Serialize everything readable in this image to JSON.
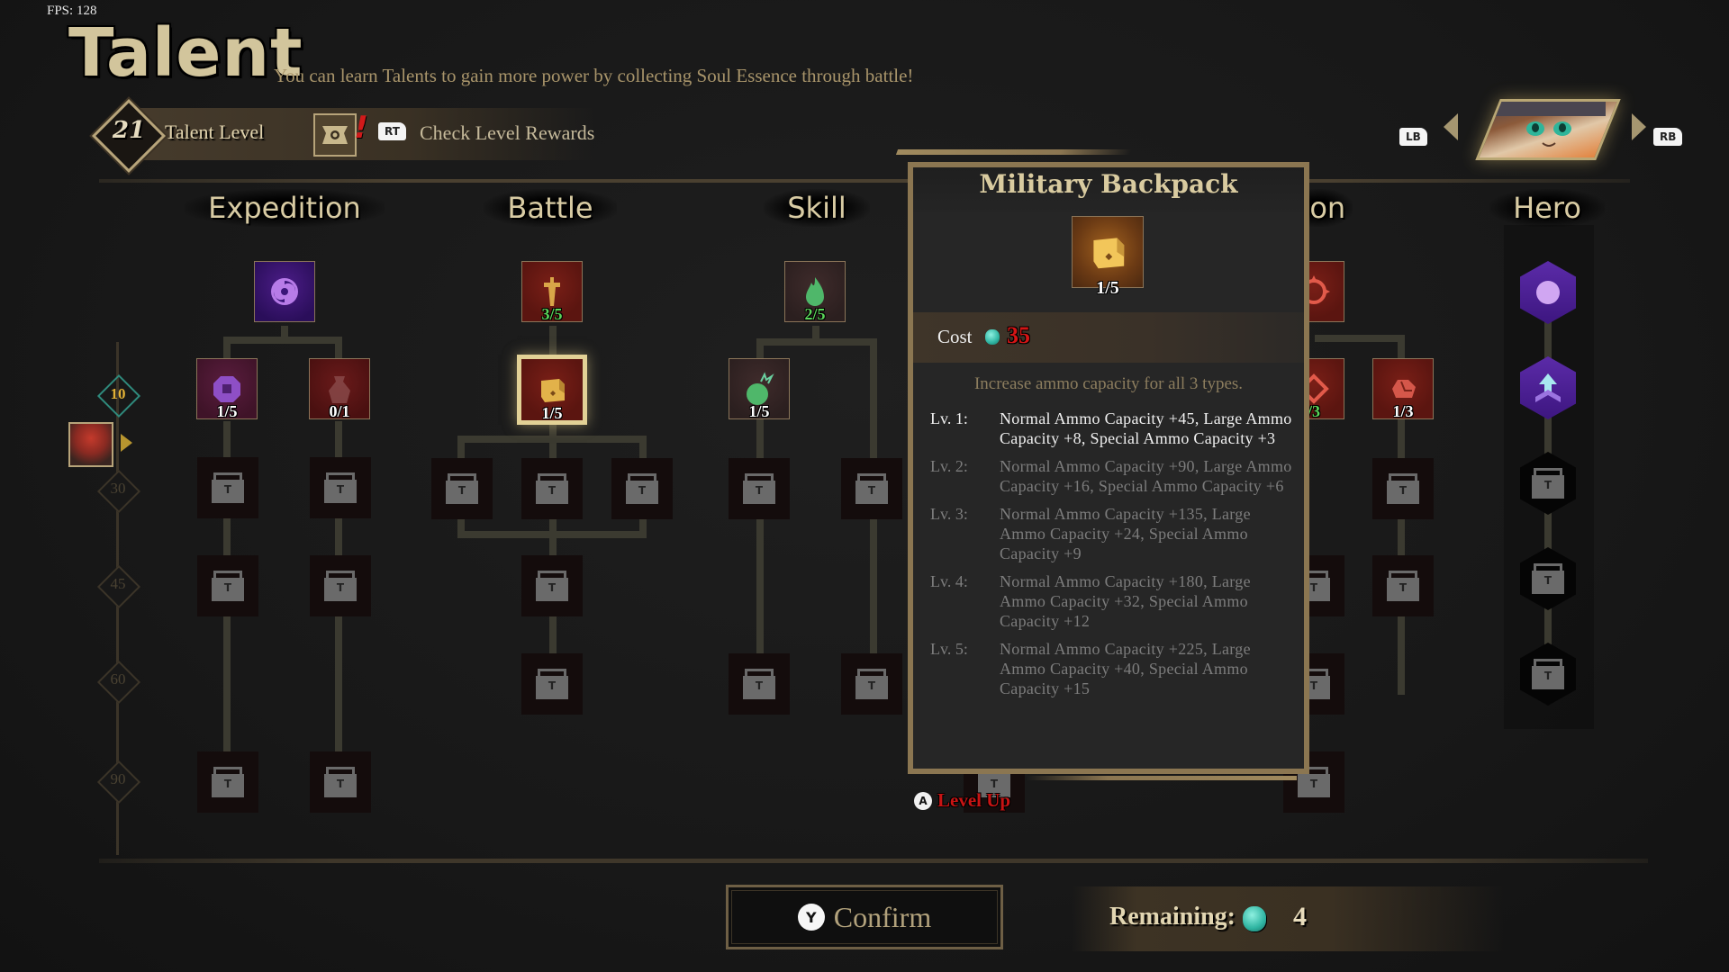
{
  "fps": "FPS: 128",
  "header": {
    "title": "Talent",
    "subtitle": "You can learn Talents to gain more power by collecting Soul Essence through battle!",
    "talent_level": "21",
    "talent_level_label": "Talent Level",
    "rewards_alert": "!",
    "rt_hint": "RT",
    "check_rewards_label": "Check Level Rewards"
  },
  "hero_selector": {
    "lb_hint": "LB",
    "rb_hint": "RB",
    "current_hero": "hero-portrait"
  },
  "columns": [
    {
      "name": "Expedition"
    },
    {
      "name": "Battle"
    },
    {
      "name": "Skill"
    },
    {
      "name": "Weapon",
      "visible_text": "pon"
    },
    {
      "name": "Hero"
    }
  ],
  "milestones": [
    {
      "label": "10",
      "active": true
    },
    {
      "label": "30",
      "active": false
    },
    {
      "label": "45",
      "active": false
    },
    {
      "label": "60",
      "active": false
    },
    {
      "label": "90",
      "active": false
    }
  ],
  "nodes": {
    "expedition_root": {
      "icon": "vortex-icon",
      "count": ""
    },
    "expedition_coin": {
      "icon": "coin-icon",
      "count": "1/5"
    },
    "expedition_pouch": {
      "icon": "pouch-icon",
      "count": "0/1"
    },
    "battle_root": {
      "icon": "sword-icon",
      "count": "3/5"
    },
    "battle_backpack": {
      "icon": "backpack-icon",
      "count": "1/5",
      "selected": true
    },
    "skill_root": {
      "icon": "flame-icon",
      "count": "2/5"
    },
    "skill_bomb": {
      "icon": "bomb-icon",
      "count": "1/5"
    },
    "weapon_root": {
      "icon": "crosshair-icon",
      "count": ""
    },
    "weapon_shield": {
      "icon": "chevron-icon",
      "count": "/3"
    },
    "weapon_rock": {
      "icon": "rock-icon",
      "count": "1/3"
    },
    "hero_orb": {
      "icon": "orb-icon"
    },
    "hero_upgrade": {
      "icon": "arrow-up-icon"
    }
  },
  "tooltip": {
    "title": "Military Backpack",
    "count": "1/5",
    "cost_label": "Cost",
    "cost_value": "35",
    "description": "Increase ammo capacity for all 3 types.",
    "current_level": 1,
    "levels": [
      {
        "label": "Lv. 1:",
        "text": "Normal Ammo Capacity +45, Large Ammo Capacity +8, Special Ammo Capacity +3"
      },
      {
        "label": "Lv. 2:",
        "text": "Normal Ammo Capacity +90, Large Ammo Capacity +16, Special Ammo Capacity +6"
      },
      {
        "label": "Lv. 3:",
        "text": "Normal Ammo Capacity +135, Large Ammo Capacity +24, Special Ammo Capacity +9"
      },
      {
        "label": "Lv. 4:",
        "text": "Normal Ammo Capacity +180, Large Ammo Capacity +32, Special Ammo Capacity +12"
      },
      {
        "label": "Lv. 5:",
        "text": "Normal Ammo Capacity +225, Large Ammo Capacity +40, Special Ammo Capacity +15"
      }
    ],
    "level_up_hint": "A",
    "level_up_label": "Level Up"
  },
  "footer": {
    "confirm_hint": "Y",
    "confirm_label": "Confirm",
    "remaining_label": "Remaining:",
    "remaining_value": "4"
  },
  "colors": {
    "accent_gold": "#d2c59c",
    "cost_red": "#d41515",
    "level_green": "#5bd65a",
    "soul_essence": "#2fb5a2",
    "milestone_active": "#e2b136"
  }
}
